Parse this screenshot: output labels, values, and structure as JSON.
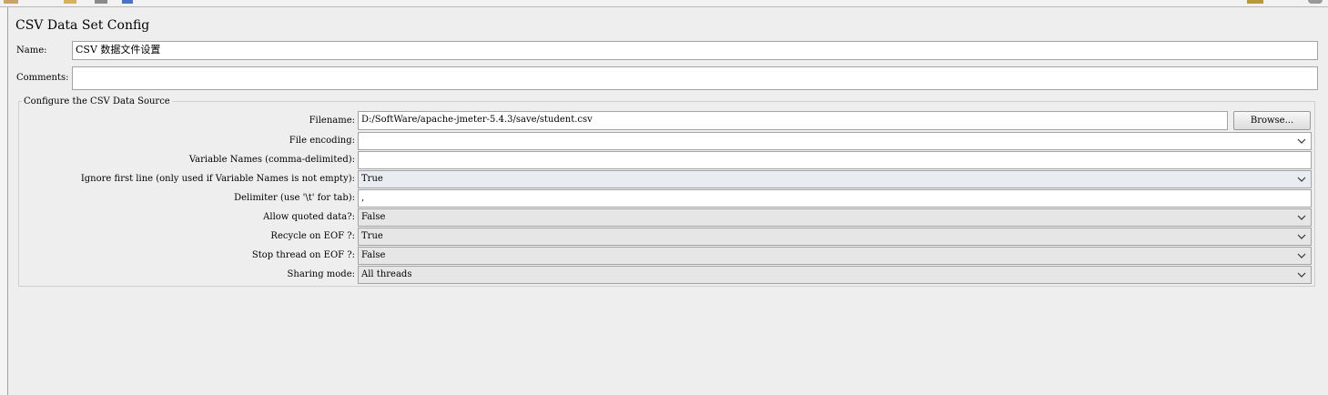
{
  "title": "CSV Data Set Config",
  "name": {
    "label": "Name:",
    "value": "CSV 数据文件设置"
  },
  "comments": {
    "label": "Comments:",
    "value": ""
  },
  "group": {
    "title": "Configure the CSV Data Source"
  },
  "filename": {
    "label": "Filename:",
    "value": "D:/SoftWare/apache-jmeter-5.4.3/save/student.csv",
    "browse_label": "Browse..."
  },
  "file_encoding": {
    "label": "File encoding:",
    "value": ""
  },
  "variable_names": {
    "label": "Variable Names (comma-delimited):",
    "value": ""
  },
  "ignore_first_line": {
    "label": "Ignore first line (only used if Variable Names is not empty):",
    "value": "True"
  },
  "delimiter": {
    "label": "Delimiter (use '\\t' for tab):",
    "value": ","
  },
  "allow_quoted": {
    "label": "Allow quoted data?:",
    "value": "False"
  },
  "recycle_eof": {
    "label": "Recycle on EOF ?:",
    "value": "True"
  },
  "stop_thread_eof": {
    "label": "Stop thread on EOF ?:",
    "value": "False"
  },
  "sharing_mode": {
    "label": "Sharing mode:",
    "value": "All threads"
  },
  "icons": {
    "dropdown": "chevron-down-icon"
  }
}
